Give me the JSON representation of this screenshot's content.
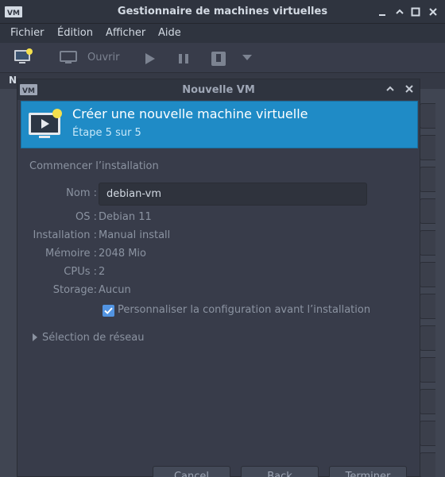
{
  "window": {
    "title": "Gestionnaire de machines virtuelles"
  },
  "menu": [
    "Fichier",
    "Édition",
    "Afficher",
    "Aide"
  ],
  "toolbar": {
    "open_label": "Ouvrir"
  },
  "list": {
    "header_col": "N"
  },
  "dialog": {
    "title": "Nouvelle VM",
    "banner_title": "Créer une nouvelle machine virtuelle",
    "banner_step": "Étape 5 sur 5",
    "section_title": "Commencer l’installation",
    "name_label": "Nom :",
    "name_value": "debian-vm",
    "os_label": "OS :",
    "os_value": "Debian 11",
    "install_label": "Installation :",
    "install_value": "Manual install",
    "memory_label": "Mémoire :",
    "memory_value": "2048 Mio",
    "cpus_label": "CPUs :",
    "cpus_value": "2",
    "storage_label": "Storage:",
    "storage_value": "Aucun",
    "customize_checked": true,
    "customize_label": "Personnaliser la configuration avant l’installation",
    "network_expander": "Sélection de réseau",
    "buttons": {
      "cancel": "Cancel",
      "back": "Back",
      "finish": "Terminer"
    }
  },
  "colors": {
    "accent": "#1f8bc6",
    "checkbox": "#5294e2",
    "background": "#383c4a"
  }
}
